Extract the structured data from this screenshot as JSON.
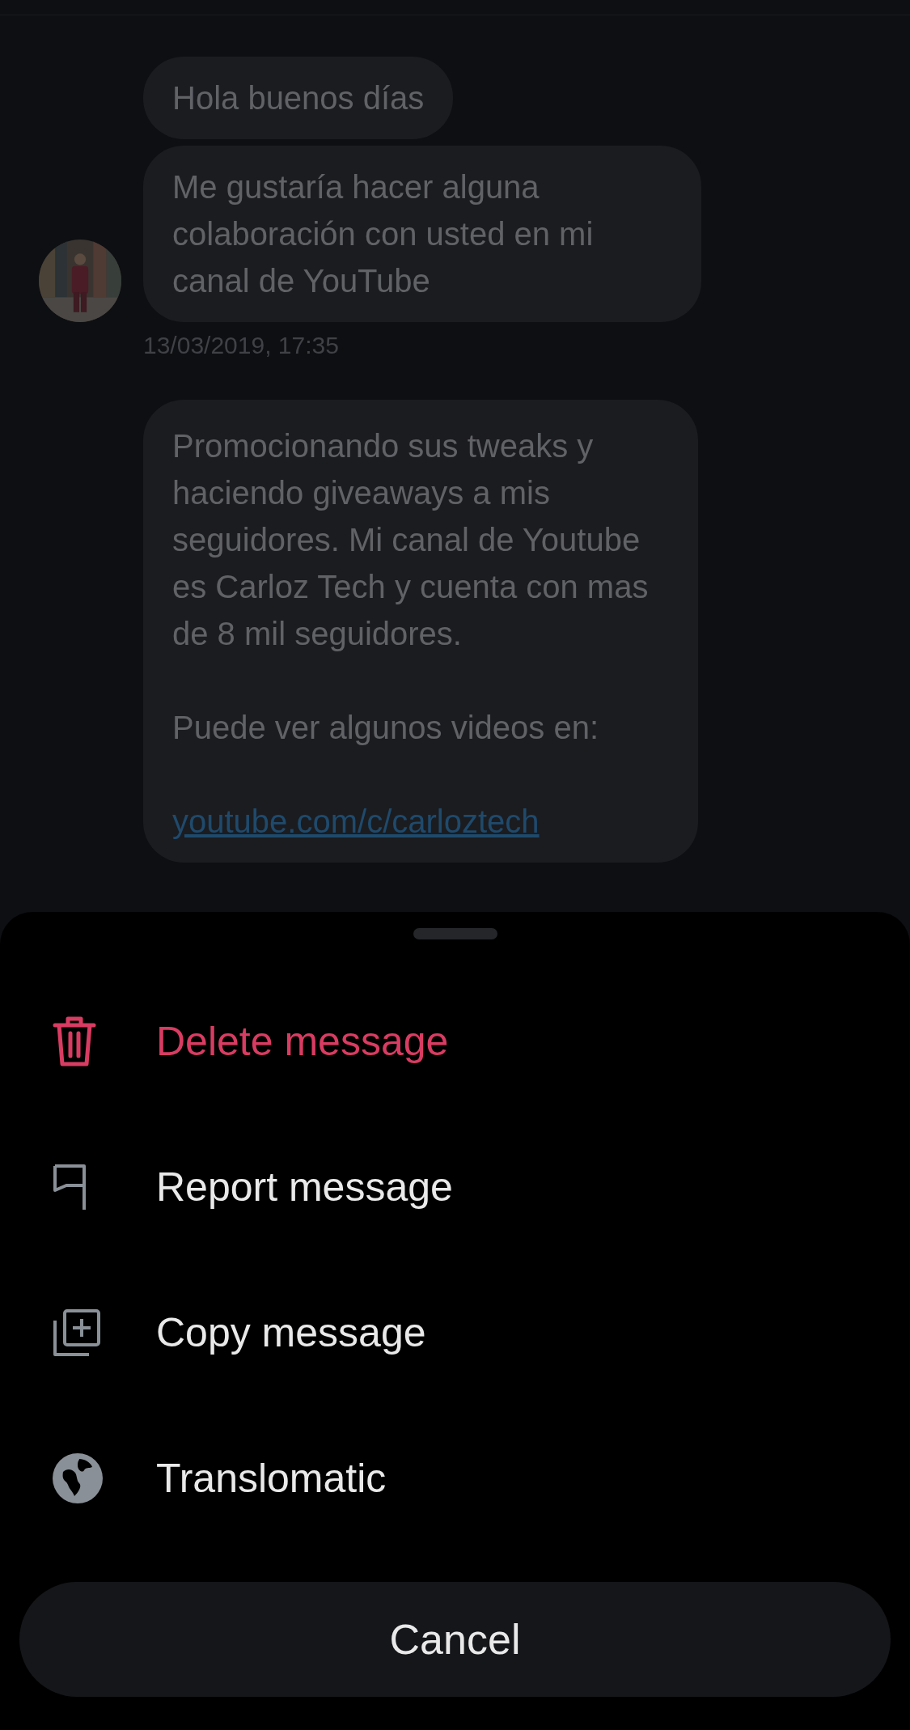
{
  "chat": {
    "messages": [
      {
        "text": "Hola buenos días"
      },
      {
        "text": "Me gustaría hacer alguna colaboración con usted en mi canal de YouTube"
      }
    ],
    "timestamp": "13/03/2019, 17:35",
    "next_message": {
      "paragraphs": [
        {
          "text": "Promocionando sus tweaks y haciendo giveaways a mis seguidores. Mi canal de Youtube es Carloz Tech y cuenta con mas de 8 mil seguidores."
        },
        {
          "text": "Puede ver algunos videos en:",
          "link": "youtube.com/c/carloztech"
        }
      ]
    }
  },
  "action_sheet": {
    "actions": [
      {
        "label": "Delete message",
        "kind": "trash",
        "destructive": true
      },
      {
        "label": "Report message",
        "kind": "flag",
        "destructive": false
      },
      {
        "label": "Copy message",
        "kind": "copy",
        "destructive": false
      },
      {
        "label": "Translomatic",
        "kind": "globe",
        "destructive": false
      }
    ],
    "cancel": "Cancel"
  }
}
